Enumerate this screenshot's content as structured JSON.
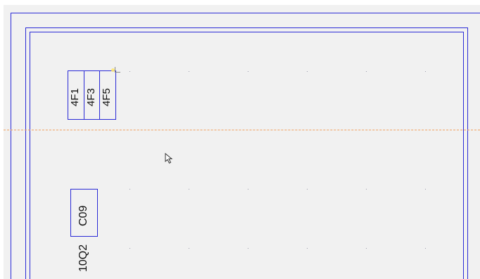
{
  "canvas": {
    "background_color": "#f1f1f1",
    "border_color": "#2a2ad6",
    "guide_color": "#f0a060"
  },
  "components": {
    "terminal_4f1": "4F1",
    "terminal_4f3": "4F3",
    "terminal_4f5": "4F5",
    "component_c09": "C09",
    "component_10q2": "10Q2"
  },
  "cursor": {
    "icon": "arrow-pointer-icon"
  }
}
